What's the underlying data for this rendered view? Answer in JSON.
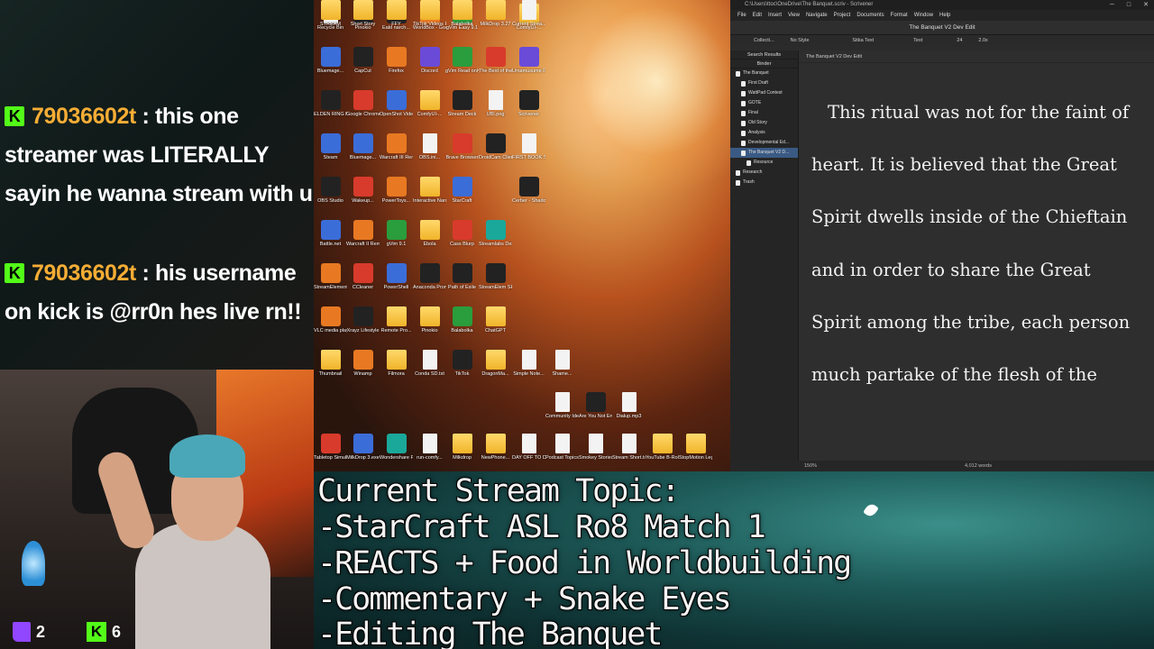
{
  "chat": {
    "messages": [
      {
        "username": "79036602t",
        "separator": " : ",
        "text": "this one streamer was LITERALLY sayin he wanna stream with u"
      },
      {
        "username": "79036602t",
        "separator": " : ",
        "text": "his username on kick is @rr0n hes live rn!!"
      }
    ],
    "kick_letter": "K"
  },
  "viewers": {
    "twitch": "2",
    "kick": "6",
    "kick_letter": "K"
  },
  "desktop": {
    "icons": [
      {
        "label": "Recycle Bin",
        "kind": "file"
      },
      {
        "label": "Pinokio",
        "kind": "dark"
      },
      {
        "label": "Eald narch...",
        "kind": "dark"
      },
      {
        "label": "WorldBox - God Sim...",
        "kind": "orange"
      },
      {
        "label": "gVim Easy 9.1",
        "kind": "green"
      },
      {
        "label": "",
        "kind": ""
      },
      {
        "label": "ComfyUI-...",
        "kind": "folder"
      },
      {
        "label": "Bluemage...",
        "kind": "app"
      },
      {
        "label": "CapCut",
        "kind": "dark"
      },
      {
        "label": "Firefox",
        "kind": "orange"
      },
      {
        "label": "Discord",
        "kind": "purple"
      },
      {
        "label": "gVim Read only 9.1",
        "kind": "green"
      },
      {
        "label": "The Best of the Beast",
        "kind": "red"
      },
      {
        "label": "Umamusume Pretty Derby",
        "kind": "purple"
      },
      {
        "label": "ELDEN RING NIGHTREIGN",
        "kind": "dark"
      },
      {
        "label": "Google Chrome",
        "kind": "red"
      },
      {
        "label": "OpenShot Video Editor",
        "kind": "app"
      },
      {
        "label": "ComfyUI-...",
        "kind": "folder"
      },
      {
        "label": "Stream Deck",
        "kind": "dark"
      },
      {
        "label": "UBI.png",
        "kind": "file"
      },
      {
        "label": "Scrivener",
        "kind": "dark"
      },
      {
        "label": "Steam",
        "kind": "app"
      },
      {
        "label": "Bluemage...",
        "kind": "app"
      },
      {
        "label": "Warcraft III Remastered",
        "kind": "orange"
      },
      {
        "label": "OBS.ini...",
        "kind": "file"
      },
      {
        "label": "Brave Browser",
        "kind": "red"
      },
      {
        "label": "DroidCam Client",
        "kind": "dark"
      },
      {
        "label": "FIRST BOOK SALE TO F...",
        "kind": "file"
      },
      {
        "label": "OBS Studio",
        "kind": "dark"
      },
      {
        "label": "Wakeup...",
        "kind": "red"
      },
      {
        "label": "PowerToys...",
        "kind": "orange"
      },
      {
        "label": "Interactive Narrator",
        "kind": "folder"
      },
      {
        "label": "StarCraft",
        "kind": "app"
      },
      {
        "label": "",
        "kind": ""
      },
      {
        "label": "Cerber - Shadows O...",
        "kind": "dark"
      },
      {
        "label": "Battle.net",
        "kind": "app"
      },
      {
        "label": "Warcraft II Remastered",
        "kind": "orange"
      },
      {
        "label": "gVim 9.1",
        "kind": "green"
      },
      {
        "label": "Ebola",
        "kind": "folder"
      },
      {
        "label": "Cass Blurp",
        "kind": "red"
      },
      {
        "label": "Streamlabs Desktop",
        "kind": "teal"
      },
      {
        "label": "",
        "kind": ""
      },
      {
        "label": "StreamElements",
        "kind": "orange"
      },
      {
        "label": "CCleaner",
        "kind": "red"
      },
      {
        "label": "PowerShell",
        "kind": "app"
      },
      {
        "label": "Anaconda Prompt (2)",
        "kind": "dark"
      },
      {
        "label": "Path of Exile",
        "kind": "dark"
      },
      {
        "label": "StreamElem SE.Live",
        "kind": "dark"
      },
      {
        "label": "",
        "kind": ""
      },
      {
        "label": "VLC media player",
        "kind": "orange"
      },
      {
        "label": "Xrayz Lifestyle",
        "kind": "dark"
      },
      {
        "label": "Remote Pro...",
        "kind": "folder"
      },
      {
        "label": "Pinokio",
        "kind": "folder"
      },
      {
        "label": "Balabolka",
        "kind": "green"
      },
      {
        "label": "ChatGPT",
        "kind": "folder"
      },
      {
        "label": "",
        "kind": ""
      },
      {
        "label": "Thumbnail",
        "kind": "folder"
      },
      {
        "label": "Winamp",
        "kind": "orange"
      },
      {
        "label": "Filmora",
        "kind": "folder"
      },
      {
        "label": "Conda SD.txt",
        "kind": "file"
      },
      {
        "label": "TikTok",
        "kind": "dark"
      },
      {
        "label": "DragonMa...",
        "kind": "folder"
      },
      {
        "label": "Simple Note...",
        "kind": "file"
      },
      {
        "label": "Tabletop Simulator",
        "kind": "red"
      },
      {
        "label": "MilkDrop 3.exe",
        "kind": "app"
      },
      {
        "label": "Wondershare Filmora 14",
        "kind": "teal"
      },
      {
        "label": "run-comfy...",
        "kind": "file"
      },
      {
        "label": "Milkdrop",
        "kind": "folder"
      },
      {
        "label": "NewPhone...",
        "kind": "folder"
      },
      {
        "label": "DAY OFF TO DO LIST.txt",
        "kind": "file"
      },
      {
        "label": "STREAM",
        "kind": "folder"
      },
      {
        "label": "Short Story",
        "kind": "folder"
      },
      {
        "label": "FFY",
        "kind": "folder"
      },
      {
        "label": "TikTok Videos Files TikTok",
        "kind": "folder"
      },
      {
        "label": "Balabolka",
        "kind": "folder"
      },
      {
        "label": "MilkDrop 3.27",
        "kind": "folder"
      },
      {
        "label": "Current Strea...",
        "kind": "file"
      }
    ],
    "extra_icons": [
      {
        "label": "Shame...",
        "kind": "file"
      },
      {
        "label": "Community Ideas.txt",
        "kind": "file"
      },
      {
        "label": "Are You Not Entertaine...",
        "kind": "dark"
      },
      {
        "label": "Dialup.mp3",
        "kind": "file"
      },
      {
        "label": "Podcast Topics.txt",
        "kind": "file"
      },
      {
        "label": "Smokey Stories.txt",
        "kind": "file"
      },
      {
        "label": "Stream Short.txt",
        "kind": "file"
      },
      {
        "label": "YouTube B-Roll a...",
        "kind": "folder"
      },
      {
        "label": "StopMotion Legge",
        "kind": "folder"
      }
    ]
  },
  "scrivener": {
    "window_title": "C:\\Users\\ttoc\\OneDrive\\The Banquet.scriv - Scrivener",
    "menu": [
      "File",
      "Edit",
      "Insert",
      "View",
      "Navigate",
      "Project",
      "Documents",
      "Format",
      "Window",
      "Help"
    ],
    "doc_title": "The Banquet V2 Dev Edit",
    "format_bar": {
      "collection": "Collecti...",
      "style": "No Style",
      "font": "Sitka Text",
      "variant": "Text",
      "size": "24",
      "spacing": "2.0x"
    },
    "binder": {
      "search_results": "Search Results",
      "header": "Binder",
      "items": [
        {
          "label": "The Banquet",
          "level": 0
        },
        {
          "label": "First Draft",
          "level": 1
        },
        {
          "label": "WattPad Contest",
          "level": 1
        },
        {
          "label": "GOTE",
          "level": 1
        },
        {
          "label": "Final",
          "level": 1
        },
        {
          "label": "Old Story",
          "level": 1
        },
        {
          "label": "Analysis",
          "level": 1
        },
        {
          "label": "Developmental Ed...",
          "level": 1
        },
        {
          "label": "The Banquet V2 D...",
          "level": 1,
          "selected": true
        },
        {
          "label": "Resource",
          "level": 2
        },
        {
          "label": "Research",
          "level": 0
        },
        {
          "label": "Trash",
          "level": 0
        }
      ]
    },
    "breadcrumb": "The Banquet V2 Dev Edit",
    "body_text": "This ritual was not for the faint of heart. It is believed that the Great Spirit dwells inside of the Chieftain and in order to share the Great Spirit among the tribe, each person much partake of the flesh of the",
    "zoom": "150%",
    "word_count": "4,012 words"
  },
  "topic": {
    "lines": [
      "Current Stream Topic:",
      "-StarCraft ASL Ro8 Match 1",
      "-REACTS + Food in Worldbuilding",
      "-Commentary + Snake Eyes",
      "-Editing The Banquet"
    ]
  }
}
